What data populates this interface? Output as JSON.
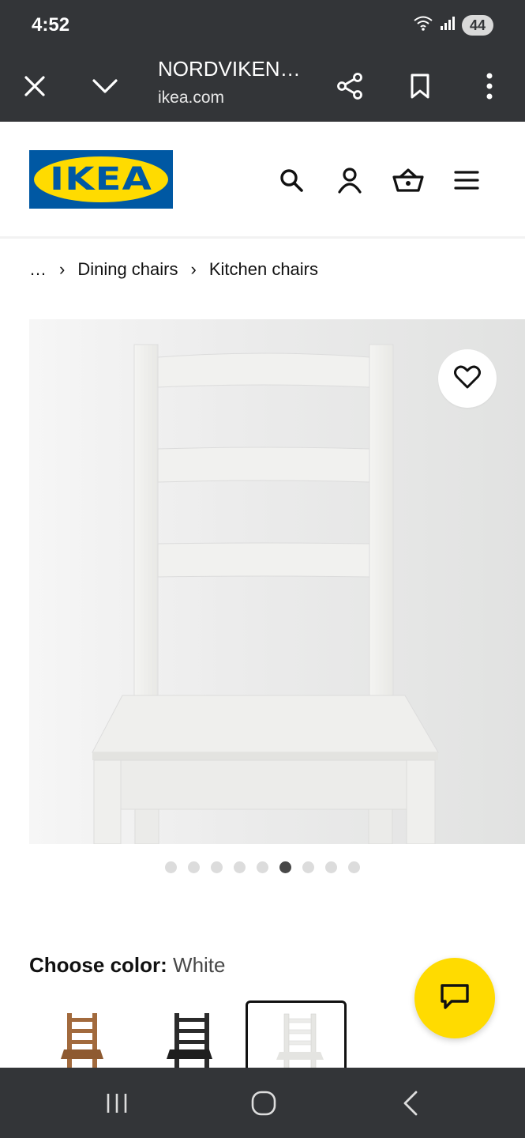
{
  "status": {
    "time": "4:52",
    "battery": "44"
  },
  "browser": {
    "tab_title": "NORDVIKEN…",
    "url": "ikea.com",
    "icons": [
      "close-icon",
      "chevron-down-icon",
      "share-icon",
      "bookmark-icon",
      "more-vert-icon"
    ]
  },
  "header": {
    "logo_text": "IKEA",
    "icons": [
      "search-icon",
      "user-icon",
      "basket-icon",
      "menu-icon"
    ]
  },
  "breadcrumb": {
    "ellipsis": "…",
    "items": [
      "Dining chairs",
      "Kitchen chairs"
    ]
  },
  "gallery": {
    "image_count": 9,
    "active_index": 5
  },
  "color": {
    "label": "Choose color:",
    "value": "White",
    "options": [
      {
        "name": "brown",
        "hex": "#a26a3d"
      },
      {
        "name": "black",
        "hex": "#2b2b2b"
      },
      {
        "name": "white",
        "hex": "#f0f0ee",
        "selected": true
      }
    ]
  },
  "colors": {
    "chrome": "#333538",
    "ikea_blue": "#0058a3",
    "ikea_yellow": "#ffdb00"
  }
}
